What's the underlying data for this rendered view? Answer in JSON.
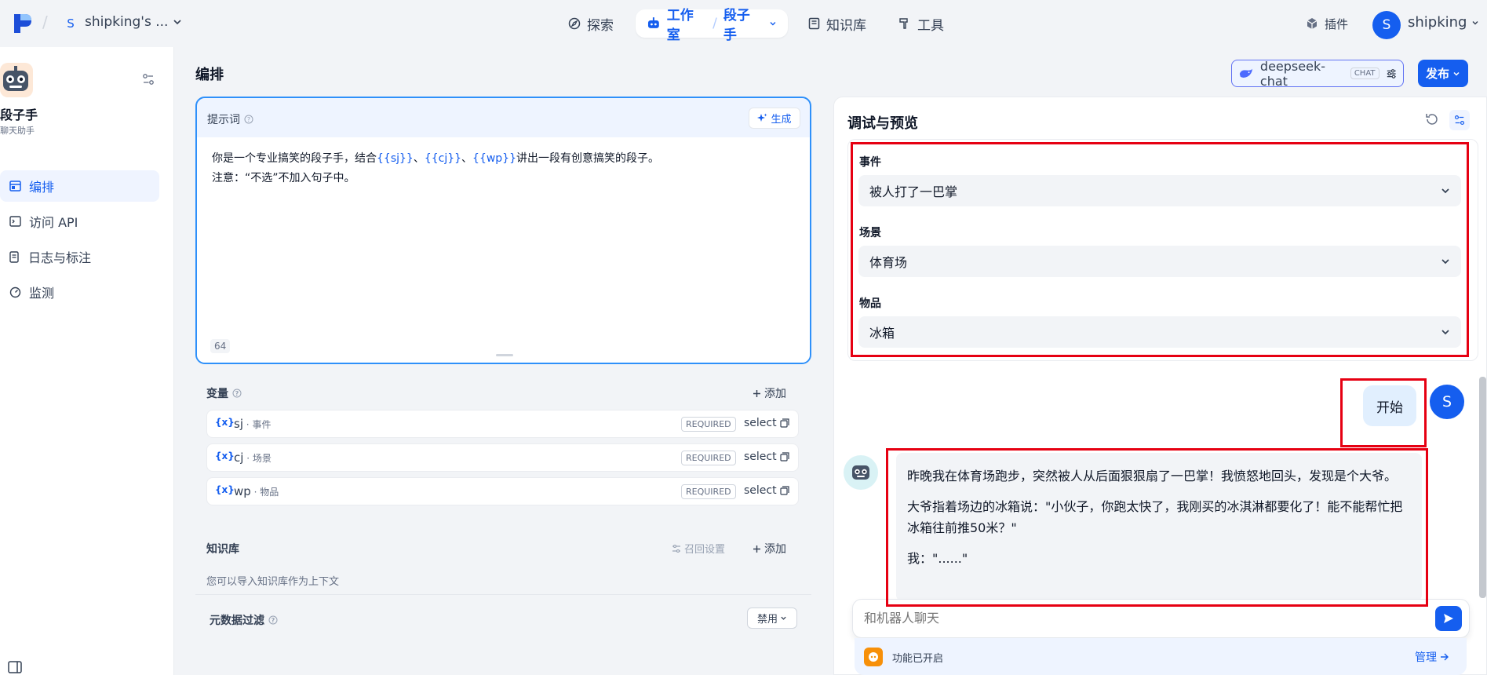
{
  "topbar": {
    "workspace_badge": "S",
    "workspace_name": "shipking's ...",
    "nav": [
      {
        "label": "探索",
        "icon": "compass-icon"
      },
      {
        "label": "知识库",
        "icon": "book-icon"
      },
      {
        "label": "工具",
        "icon": "hammer-icon"
      }
    ],
    "studio_label": "工作室",
    "studio_app": "段子手",
    "plugin_label": "插件",
    "user_initial": "S",
    "user_name": "shipking"
  },
  "sidebar": {
    "app_title": "段子手",
    "app_subtitle": "聊天助手",
    "items": [
      {
        "label": "编排",
        "icon": "layout-icon"
      },
      {
        "label": "访问 API",
        "icon": "terminal-icon"
      },
      {
        "label": "日志与标注",
        "icon": "log-icon"
      },
      {
        "label": "监测",
        "icon": "gauge-icon"
      }
    ]
  },
  "main": {
    "title": "编排",
    "model_name": "deepseek-chat",
    "model_tag": "CHAT",
    "publish_label": "发布"
  },
  "prompt": {
    "label": "提示词",
    "generate_label": "生成",
    "line1_a": "你是一个专业搞笑的段子手，结合",
    "var1": "{{sj}}",
    "sep1": "、",
    "var2": "{{cj}}",
    "sep2": "、",
    "var3": "{{wp}}",
    "line1_b": "讲出一段有创意搞笑的段子。",
    "line2": "注意：“不选”不加入句子中。",
    "char_count": "64"
  },
  "variables": {
    "title": "变量",
    "add_label": "添加",
    "items": [
      {
        "key": "sj",
        "desc": "事件",
        "required": "REQUIRED",
        "type": "select"
      },
      {
        "key": "cj",
        "desc": "场景",
        "required": "REQUIRED",
        "type": "select"
      },
      {
        "key": "wp",
        "desc": "物品",
        "required": "REQUIRED",
        "type": "select"
      }
    ]
  },
  "knowledge": {
    "title": "知识库",
    "recall_label": "召回设置",
    "add_label": "添加",
    "hint": "您可以导入知识库作为上下文",
    "metadata_label": "元数据过滤",
    "metadata_value": "禁用"
  },
  "preview": {
    "title": "调试与预览",
    "fields": [
      {
        "label": "事件",
        "value": "被人打了一巴掌"
      },
      {
        "label": "场景",
        "value": "体育场"
      },
      {
        "label": "物品",
        "value": "冰箱"
      }
    ],
    "user_message": "开始",
    "user_initial": "S",
    "answer": [
      "昨晚我在体育场跑步，突然被人从后面狠狠扇了一巴掌！我愤怒地回头，发现是个大爷。",
      "大爷指着场边的冰箱说：\"小伙子，你跑太快了，我刚买的冰淇淋都要化了！能不能帮忙把冰箱往前推50米？\"",
      "我：\"......\""
    ],
    "input_placeholder": "和机器人聊天",
    "feature_label": "功能已开启",
    "manage_label": "管理"
  },
  "colors": {
    "accent": "#155eef",
    "highlight_border": "#e60012"
  }
}
